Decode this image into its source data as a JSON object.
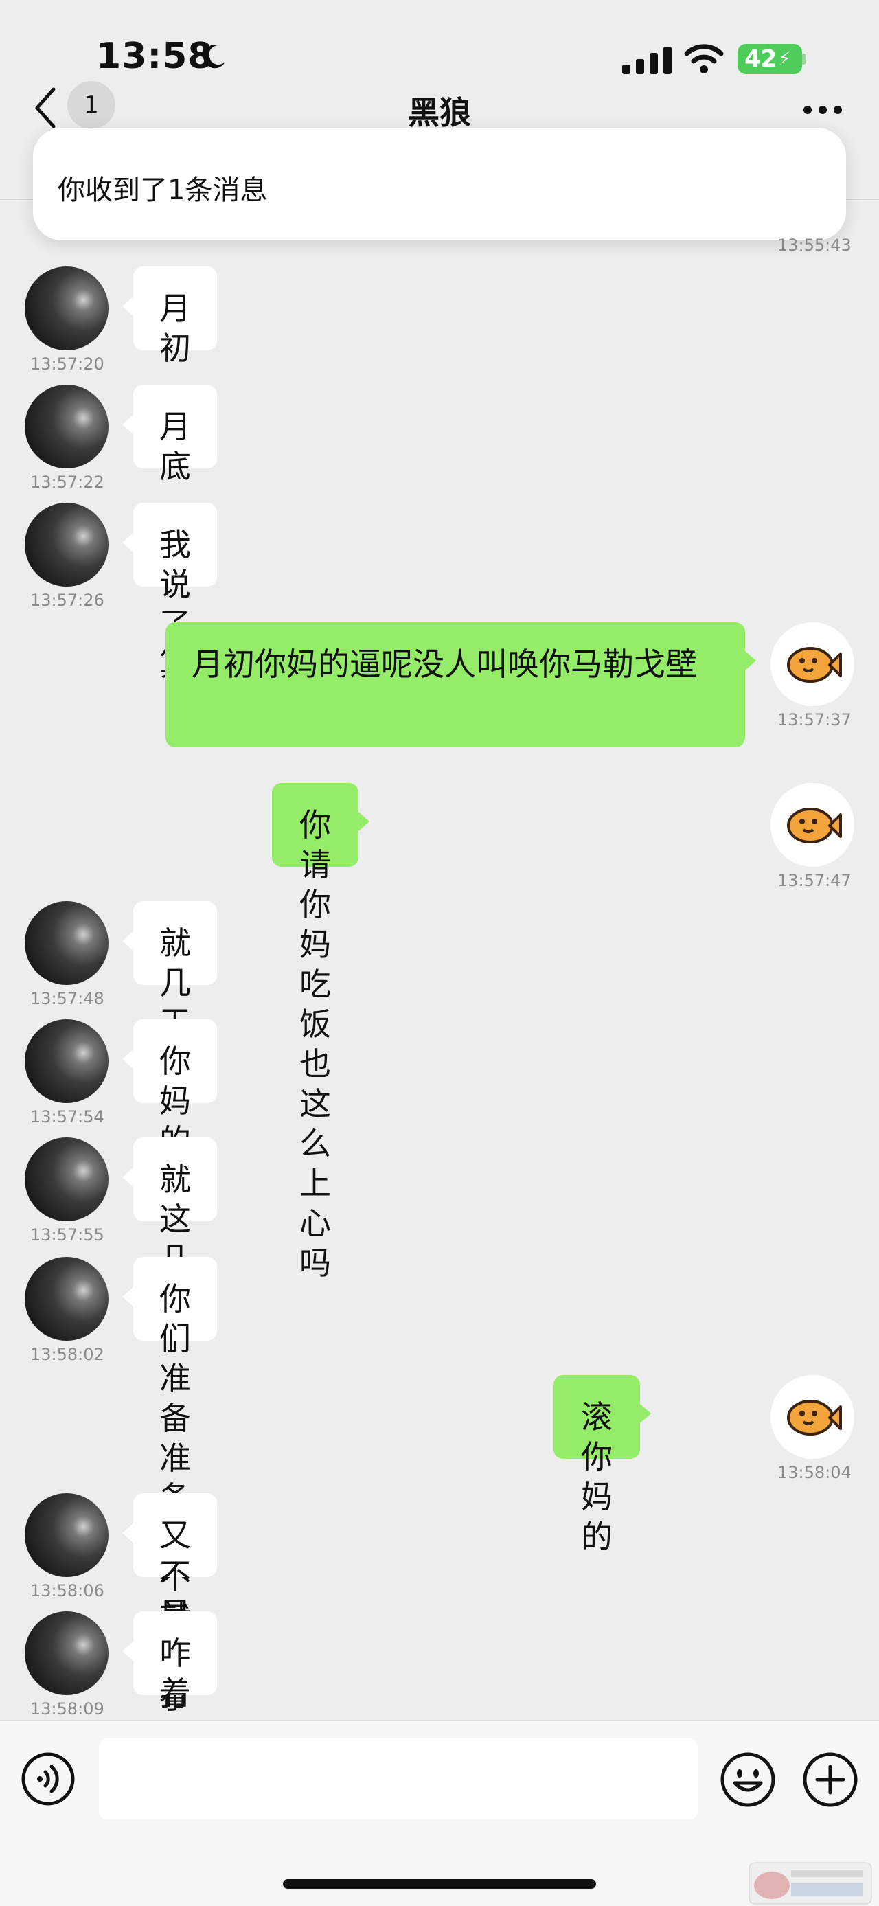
{
  "status_bar": {
    "time": "13:58",
    "battery": "42"
  },
  "nav": {
    "title": "黑狼",
    "unread_count": "1"
  },
  "notification": {
    "text": "你收到了1条消息"
  },
  "earlier_timestamp": "13:55:43",
  "messages": [
    {
      "side": "in",
      "text": "月初",
      "time": "13:57:20"
    },
    {
      "side": "in",
      "text": "月底",
      "time": "13:57:22"
    },
    {
      "side": "in",
      "text": "我说了算",
      "time": "13:57:26"
    },
    {
      "side": "out",
      "text": "月初你妈的逼呢没人叫唤你马勒戈壁",
      "time": "13:57:37"
    },
    {
      "side": "out",
      "text": "你请你妈吃饭也这么上心吗",
      "time": "13:57:47"
    },
    {
      "side": "in",
      "text": "就几天",
      "time": "13:57:48"
    },
    {
      "side": "in",
      "text": "你妈的",
      "time": "13:57:54"
    },
    {
      "side": "in",
      "text": "就这几天了",
      "time": "13:57:55"
    },
    {
      "side": "in",
      "text": "你们准备准备人不就行了",
      "time": "13:58:02"
    },
    {
      "side": "out",
      "text": "滚你妈的",
      "time": "13:58:04"
    },
    {
      "side": "in",
      "text": "又不是不打",
      "time": "13:58:06"
    },
    {
      "side": "in",
      "text": "咋着",
      "time": "13:58:09"
    }
  ],
  "colors": {
    "background": "#ededed",
    "outgoing_bubble": "#95ec69",
    "incoming_bubble": "#ffffff",
    "battery": "#4fcd5a"
  }
}
